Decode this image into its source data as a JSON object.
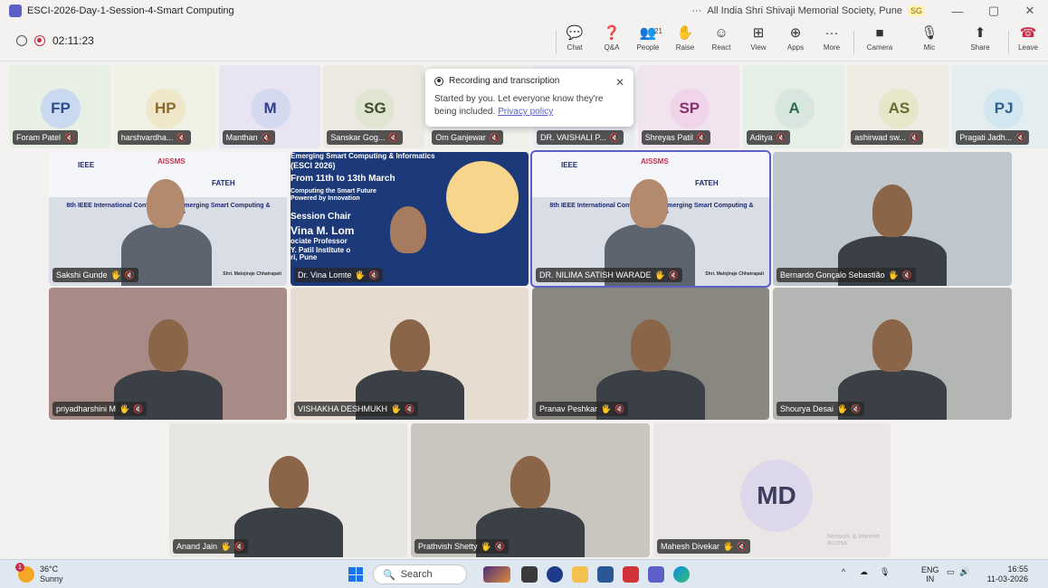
{
  "window": {
    "title": "ESCI-2026-Day-1-Session-4-Smart Computing",
    "org_dots": "···",
    "org": "All India Shri Shivaji Memorial Society, Pune",
    "user_initials": "SG",
    "min": "—",
    "restore": "▢",
    "close": "✕"
  },
  "toolbar": {
    "timer": "02:11:23",
    "buttons": [
      {
        "label": "Chat",
        "icon": "chat-icon",
        "glyph": "💬"
      },
      {
        "label": "Q&A",
        "icon": "qa-icon",
        "glyph": "❓"
      },
      {
        "label": "People",
        "icon": "people-icon",
        "glyph": "👥",
        "count": "21"
      },
      {
        "label": "Raise",
        "icon": "hand-icon",
        "glyph": "✋"
      },
      {
        "label": "React",
        "icon": "smile-icon",
        "glyph": "☺"
      },
      {
        "label": "View",
        "icon": "grid-icon",
        "glyph": "⊞"
      },
      {
        "label": "Apps",
        "icon": "plus-icon",
        "glyph": "⊕"
      },
      {
        "label": "More",
        "icon": "more-icon",
        "glyph": "···"
      },
      {
        "label": "Camera",
        "icon": "camera-icon",
        "glyph": "■"
      },
      {
        "label": "Mic",
        "icon": "mic-off-icon",
        "glyph": "🎙"
      },
      {
        "label": "Share",
        "icon": "share-icon",
        "glyph": "⬆"
      },
      {
        "label": "Leave",
        "icon": "phone-icon",
        "glyph": "☎"
      }
    ]
  },
  "toast": {
    "title": "Recording and transcription",
    "body": "Started by you. Let everyone know they're being included.",
    "link": "Privacy policy"
  },
  "strip": [
    {
      "initials": "FP",
      "name": "Foram Patel",
      "bg": "#e8efe3",
      "avatar": "#c9d9f0",
      "color": "#2f4e8c"
    },
    {
      "initials": "HP",
      "name": "harshvardha...",
      "bg": "#eef1e3",
      "avatar": "#f0e6c9",
      "color": "#8c6a2f"
    },
    {
      "initials": "M",
      "name": "Manthan",
      "bg": "#e9e4f1",
      "avatar": "#d5d9f0",
      "color": "#2f3e8c"
    },
    {
      "initials": "SG",
      "name": "Sanskar Gog...",
      "bg": "#ece9e2",
      "avatar": "#e0e5d2",
      "color": "#3f4a2a"
    },
    {
      "initials": "",
      "name": "Om Ganjewar",
      "bg": "#eef0ea",
      "avatar": "#eef0ea",
      "color": "#333"
    },
    {
      "initials": "",
      "name": "DR. VAISHALI P...",
      "bg": "#e8ecf2",
      "avatar": "#e8ecf2",
      "color": "#333"
    },
    {
      "initials": "SP",
      "name": "Shreyas Patil",
      "bg": "#f1e4ef",
      "avatar": "#f0d5ea",
      "color": "#8c2f6e"
    },
    {
      "initials": "A",
      "name": "Aditya",
      "bg": "#e6eee8",
      "avatar": "#d7e6df",
      "color": "#2f6a50"
    },
    {
      "initials": "AS",
      "name": "ashirwad sw...",
      "bg": "#efece3",
      "avatar": "#e6e6c9",
      "color": "#6a6a2f"
    },
    {
      "initials": "PJ",
      "name": "Pragati Jadh...",
      "bg": "#e4eef1",
      "avatar": "#d2e6f0",
      "color": "#2f5e8c"
    }
  ],
  "grid": [
    {
      "name": "Sakshi Gunde",
      "kind": "conf",
      "bg": "#d9dde6",
      "active": false
    },
    {
      "name": "Dr. Vina Lomte",
      "kind": "poster",
      "bg": "#1c3a7a",
      "active": false
    },
    {
      "name": "DR. NILIMA SATISH WARADE",
      "kind": "conf",
      "bg": "#d9dde6",
      "active": true
    },
    {
      "name": "Bernardo Gonçalo Sebastião",
      "kind": "cam",
      "bg": "#bfc7cc",
      "active": false
    },
    {
      "name": "priyadharshini M",
      "kind": "cam",
      "bg": "#a88b86",
      "active": false
    },
    {
      "name": "VISHAKHA DESHMUKH",
      "kind": "cam",
      "bg": "#e6ddd0",
      "active": false
    },
    {
      "name": "Pranav Peshkar",
      "kind": "cam",
      "bg": "#8a8780",
      "active": false
    },
    {
      "name": "Shourya Desai",
      "kind": "cam",
      "bg": "#b4b6b3",
      "active": false
    },
    {
      "name": "Anand Jain",
      "kind": "cam",
      "bg": "#e8e6e2",
      "active": false
    },
    {
      "name": "Prathvish Shetty",
      "kind": "cam",
      "bg": "#c9c6c0",
      "active": false
    },
    {
      "name": "Mahesh Divekar",
      "kind": "avatar",
      "bg": "#ebe6e6",
      "active": false,
      "initials": "MD"
    }
  ],
  "poster": {
    "line1": "Emerging Smart Computing & Informatics",
    "line2": "(ESCI 2026)",
    "line3": "From 11th to 13th March",
    "line4": "Computing the Smart Future",
    "line5": "Powered by Innovation",
    "line6": "Session Chair",
    "line7": "Vina M. Lom",
    "line8": "ociate Professor",
    "line9": "Y. Patil Institute o",
    "line10": "ri, Pune"
  },
  "conf_banner": {
    "org1": "IEEE",
    "org2": "AISSMS",
    "partner": "FATEH",
    "conference": "8th IEEE International Conference on Emerging Smart Computing & Informatics",
    "chhatrapati": "Shri. Malojiraje Chhatrapati"
  },
  "watermark": "Network & internet access",
  "taskbar": {
    "temp": "36°C",
    "weather": "Sunny",
    "badge": "1",
    "search": "Search",
    "lang1": "ENG",
    "lang2": "IN",
    "time": "16:55",
    "date": "11-03-2026"
  }
}
